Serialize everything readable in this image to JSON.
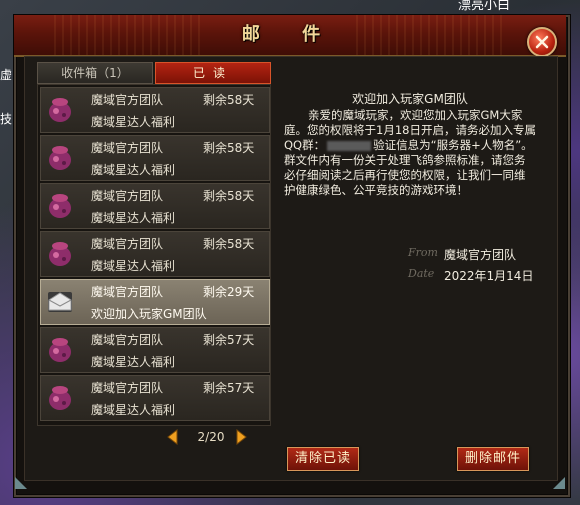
{
  "window": {
    "title": "邮 件"
  },
  "background": {
    "left_text_1": "虚",
    "left_text_2": "技",
    "top_right_text": "漂亮小白"
  },
  "tabs": [
    {
      "label": "收件箱（1）"
    },
    {
      "label": "已读"
    }
  ],
  "mails": [
    {
      "sender": "魔域官方团队",
      "remain": "剩余58天",
      "subject": "魔域星达人福利",
      "icon": "pouch-icon",
      "selected": false
    },
    {
      "sender": "魔域官方团队",
      "remain": "剩余58天",
      "subject": "魔域星达人福利",
      "icon": "pouch-icon",
      "selected": false
    },
    {
      "sender": "魔域官方团队",
      "remain": "剩余58天",
      "subject": "魔域星达人福利",
      "icon": "pouch-icon",
      "selected": false
    },
    {
      "sender": "魔域官方团队",
      "remain": "剩余58天",
      "subject": "魔域星达人福利",
      "icon": "pouch-icon",
      "selected": false
    },
    {
      "sender": "魔域官方团队",
      "remain": "剩余29天",
      "subject": "欢迎加入玩家GM团队",
      "icon": "envelope-icon",
      "selected": true
    },
    {
      "sender": "魔域官方团队",
      "remain": "剩余57天",
      "subject": "魔域星达人福利",
      "icon": "pouch-icon",
      "selected": false
    },
    {
      "sender": "魔域官方团队",
      "remain": "剩余57天",
      "subject": "魔域星达人福利",
      "icon": "pouch-icon",
      "selected": false
    }
  ],
  "pager": {
    "page": "2/20"
  },
  "reader": {
    "title": "欢迎加入玩家GM团队",
    "body_part1": "亲爱的魔域玩家，欢迎您加入玩家GM大家庭。您的权限将于1月18日开启，请务必加入专属QQ群：",
    "body_part2": "验证信息为“服务器+人物名”。群文件内有一份关于处理飞鸽参照标准，请您务必仔细阅读之后再行使您的权限，让我们一同维护健康绿色、公平竞技的游戏环境！",
    "from_label": "From",
    "from_value": "魔域官方团队",
    "date_label": "Date",
    "date_value": "2022年1月14日"
  },
  "buttons": {
    "clear_read": "清除已读",
    "delete_mail": "删除邮件"
  },
  "colors": {
    "accent": "#b42412",
    "text": "#f1ecdf",
    "frame": "#4a4035"
  }
}
